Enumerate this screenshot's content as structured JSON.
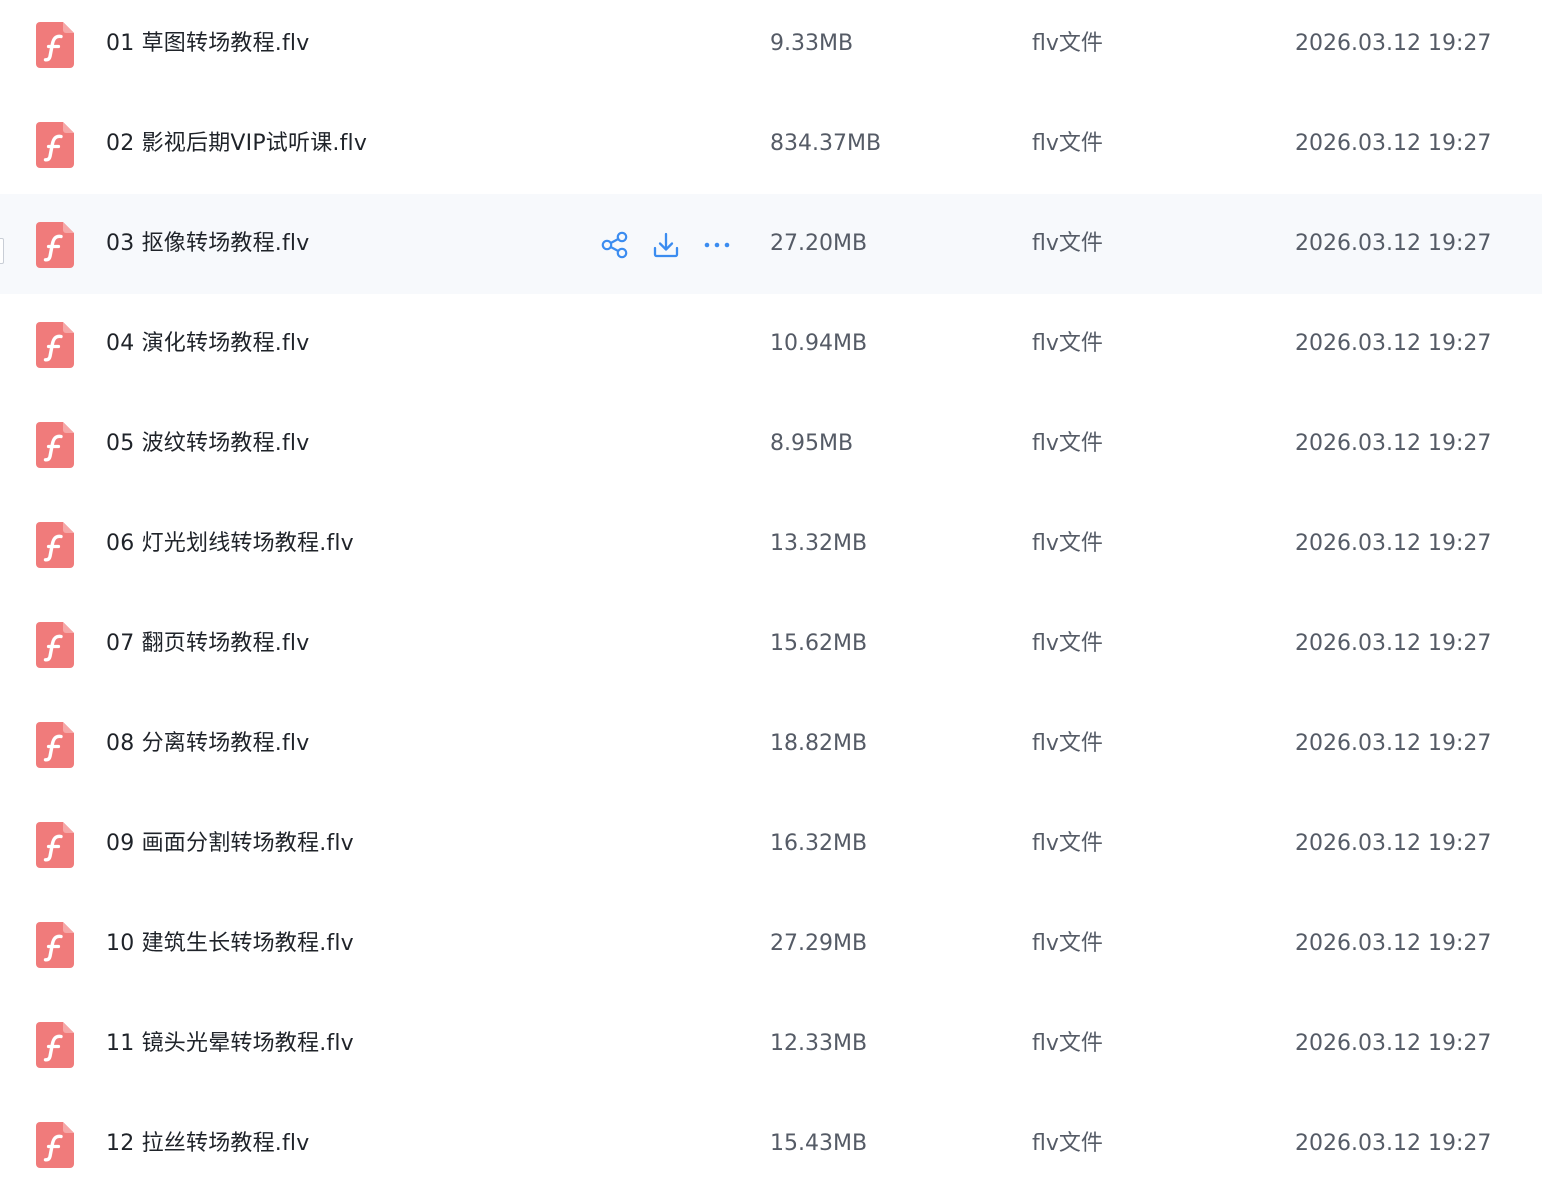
{
  "colors": {
    "icon_fill": "#f07b7b",
    "accent": "#3b8cf0",
    "hover_row": "#f7f9fc"
  },
  "actions": {
    "share_icon": "share-icon",
    "download_icon": "download-icon",
    "more_icon": "more-dots-icon"
  },
  "files": [
    {
      "name": "01 草图转场教程.flv",
      "size": "9.33MB",
      "type": "flv文件",
      "date": "2026.03.12 19:27"
    },
    {
      "name": "02 影视后期VIP试听课.flv",
      "size": "834.37MB",
      "type": "flv文件",
      "date": "2026.03.12 19:27"
    },
    {
      "name": "03 抠像转场教程.flv",
      "size": "27.20MB",
      "type": "flv文件",
      "date": "2026.03.12 19:27"
    },
    {
      "name": "04 演化转场教程.flv",
      "size": "10.94MB",
      "type": "flv文件",
      "date": "2026.03.12 19:27"
    },
    {
      "name": "05 波纹转场教程.flv",
      "size": "8.95MB",
      "type": "flv文件",
      "date": "2026.03.12 19:27"
    },
    {
      "name": "06 灯光划线转场教程.flv",
      "size": "13.32MB",
      "type": "flv文件",
      "date": "2026.03.12 19:27"
    },
    {
      "name": "07 翻页转场教程.flv",
      "size": "15.62MB",
      "type": "flv文件",
      "date": "2026.03.12 19:27"
    },
    {
      "name": "08 分离转场教程.flv",
      "size": "18.82MB",
      "type": "flv文件",
      "date": "2026.03.12 19:27"
    },
    {
      "name": "09 画面分割转场教程.flv",
      "size": "16.32MB",
      "type": "flv文件",
      "date": "2026.03.12 19:27"
    },
    {
      "name": "10 建筑生长转场教程.flv",
      "size": "27.29MB",
      "type": "flv文件",
      "date": "2026.03.12 19:27"
    },
    {
      "name": "11 镜头光晕转场教程.flv",
      "size": "12.33MB",
      "type": "flv文件",
      "date": "2026.03.12 19:27"
    },
    {
      "name": "12 拉丝转场教程.flv",
      "size": "15.43MB",
      "type": "flv文件",
      "date": "2026.03.12 19:27"
    }
  ]
}
